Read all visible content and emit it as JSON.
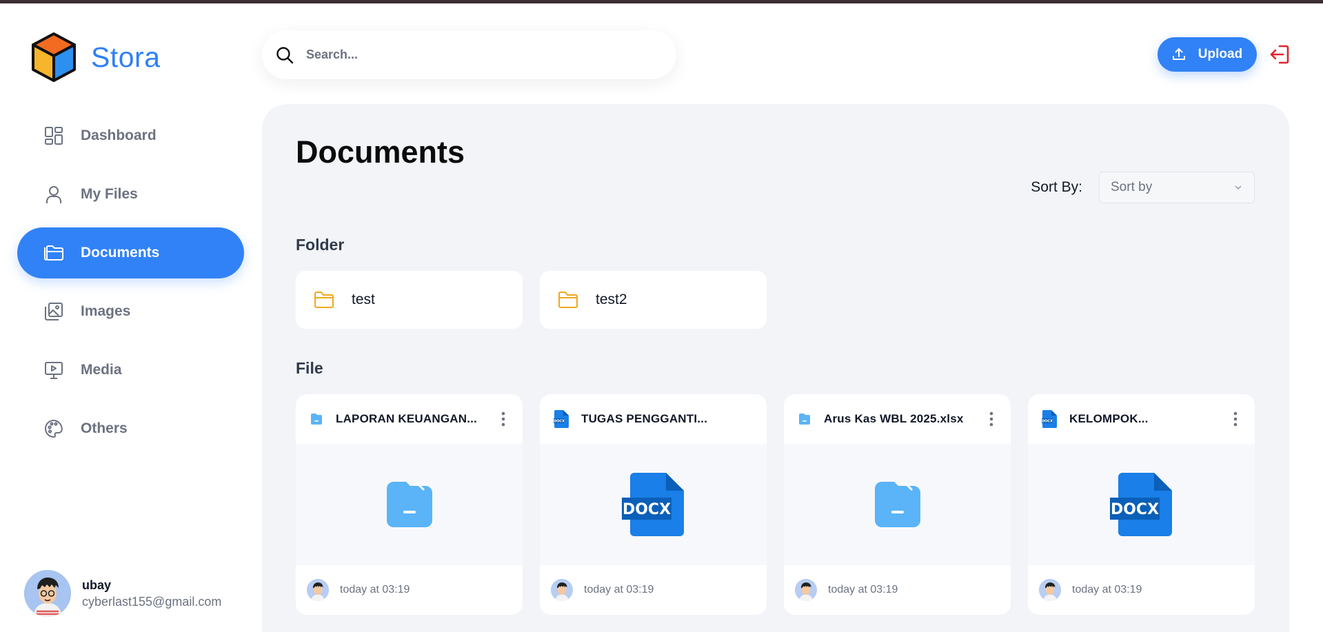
{
  "app": {
    "brand_name": "Stora",
    "accent": "#3182f6"
  },
  "search": {
    "placeholder": "Search..."
  },
  "header": {
    "upload_label": "Upload",
    "logout_icon": "logout-icon",
    "logout_color": "#e0242c"
  },
  "sidebar": {
    "items": [
      {
        "label": "Dashboard",
        "icon": "dashboard-icon",
        "active": false
      },
      {
        "label": "My Files",
        "icon": "user-icon",
        "active": false
      },
      {
        "label": "Documents",
        "icon": "documents-icon",
        "active": true
      },
      {
        "label": "Images",
        "icon": "images-icon",
        "active": false
      },
      {
        "label": "Media",
        "icon": "media-icon",
        "active": false
      },
      {
        "label": "Others",
        "icon": "palette-icon",
        "active": false
      }
    ]
  },
  "profile": {
    "name": "ubay",
    "email": "cyberlast155@gmail.com"
  },
  "main": {
    "title": "Documents",
    "sort_label": "Sort By:",
    "sort_value": "Sort by",
    "folder_section": "Folder",
    "file_section": "File",
    "folders": [
      {
        "name": "test"
      },
      {
        "name": "test2"
      }
    ],
    "files": [
      {
        "name": "LAPORAN KEUANGAN...",
        "type": "generic",
        "time": "today at 03:19"
      },
      {
        "name": "TUGAS PENGGANTI...",
        "type": "docx",
        "time": "today at 03:19"
      },
      {
        "name": "Arus Kas WBL 2025.xlsx",
        "type": "generic",
        "time": "today at 03:19"
      },
      {
        "name": "KELOMPOK...",
        "type": "docx",
        "time": "today at 03:19"
      }
    ]
  }
}
